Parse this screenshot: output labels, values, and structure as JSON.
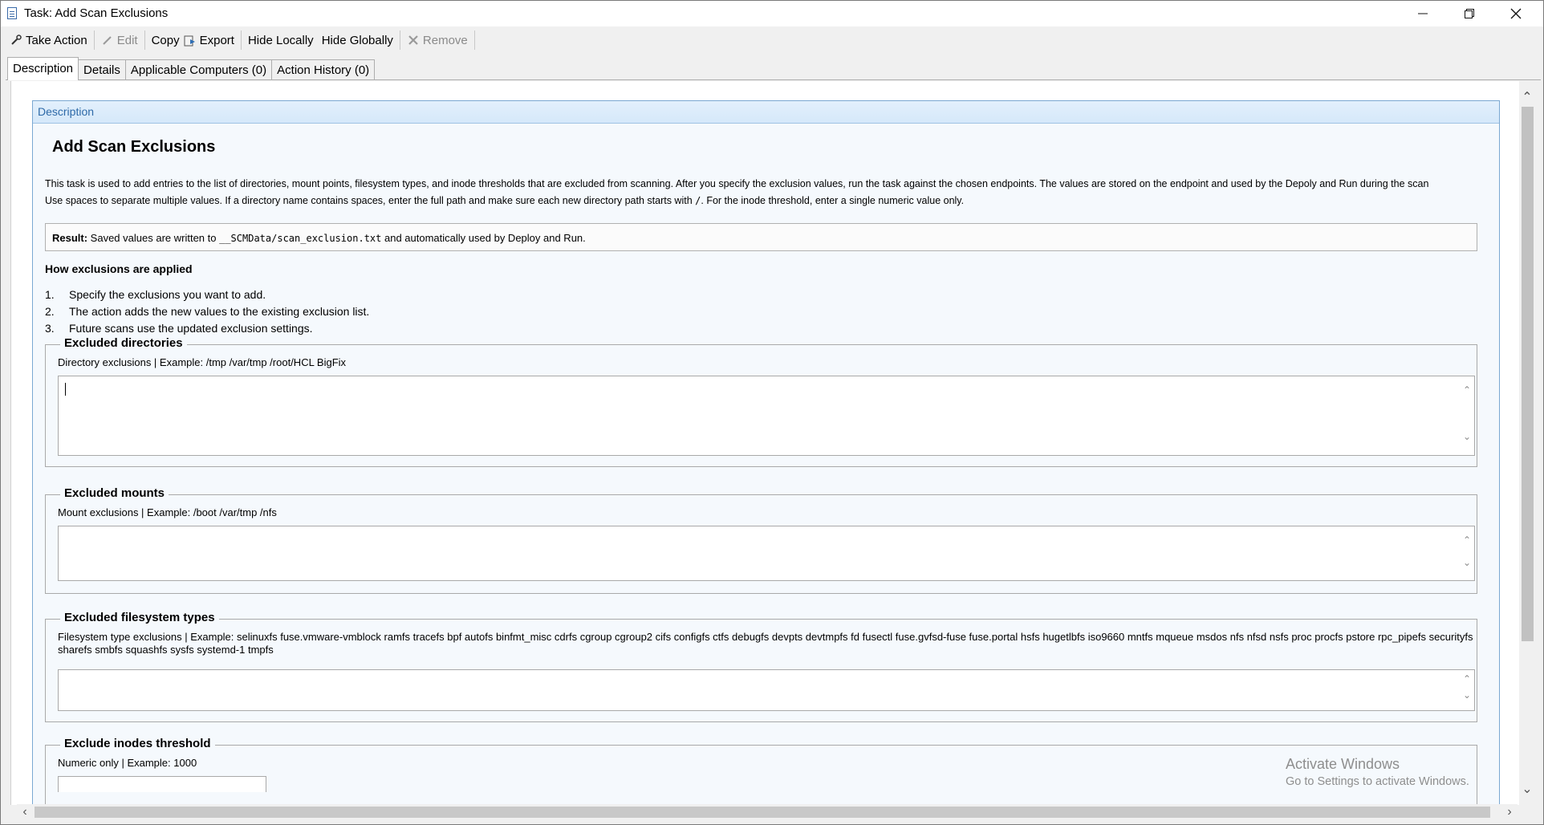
{
  "window": {
    "title": "Task: Add Scan Exclusions",
    "minimize_icon": "minimize-icon",
    "restore_icon": "restore-icon",
    "close_icon": "close-icon"
  },
  "toolbar": {
    "take_action": "Take Action",
    "edit": "Edit",
    "copy": "Copy",
    "export": "Export",
    "hide_locally": "Hide Locally",
    "hide_globally": "Hide Globally",
    "remove": "Remove"
  },
  "tabs": {
    "description": "Description",
    "details": "Details",
    "applicable_computers": "Applicable Computers (0)",
    "action_history": "Action History (0)"
  },
  "panel": {
    "header": "Description",
    "title": "Add Scan Exclusions",
    "intro1": "This task is used to add entries to the list of directories, mount points, filesystem types, and inode thresholds that are excluded from scanning. After you specify the exclusion values, run the task against the chosen endpoints. The values are stored on the endpoint and used by the Depoly and Run during the scan",
    "intro2a": "Use spaces to separate multiple values. If a directory name contains spaces, enter the full path and make sure each new directory path starts with ",
    "intro2_code": "/",
    "intro2b": ". For the inode threshold, enter a single numeric value only.",
    "result_label": "Result:",
    "result_text_a": " Saved values are written to ",
    "result_code": "__SCMData/scan_exclusion.txt",
    "result_text_b": " and automatically used by Deploy and Run.",
    "how_title": "How exclusions are applied",
    "steps": [
      {
        "num": "1.",
        "text": "Specify the exclusions you want to add."
      },
      {
        "num": "2.",
        "text": "The action adds the new values to the existing exclusion list."
      },
      {
        "num": "3.",
        "text": "Future scans use the updated exclusion settings."
      }
    ],
    "fields": {
      "directories": {
        "legend": "Excluded directories",
        "hint": "Directory exclusions | Example: /tmp /var/tmp /root/HCL BigFix",
        "value": ""
      },
      "mounts": {
        "legend": "Excluded mounts",
        "hint": "Mount exclusions | Example: /boot /var/tmp /nfs",
        "value": ""
      },
      "filesystems": {
        "legend": "Excluded filesystem types",
        "hint": "Filesystem type exclusions | Example: selinuxfs fuse.vmware-vmblock ramfs tracefs bpf autofs binfmt_misc cdrfs cgroup cgroup2 cifs configfs ctfs debugfs devpts devtmpfs fd fusectl fuse.gvfsd-fuse fuse.portal hsfs hugetlbfs iso9660 mntfs mqueue msdos nfs nfsd nsfs proc procfs pstore rpc_pipefs securityfs sharefs smbfs squashfs sysfs systemd-1 tmpfs",
        "value": ""
      },
      "inodes": {
        "legend": "Exclude inodes threshold",
        "hint": "Numeric only | Example: 1000",
        "value": ""
      }
    }
  },
  "watermark": {
    "line1": "Activate Windows",
    "line2": "Go to Settings to activate Windows."
  }
}
